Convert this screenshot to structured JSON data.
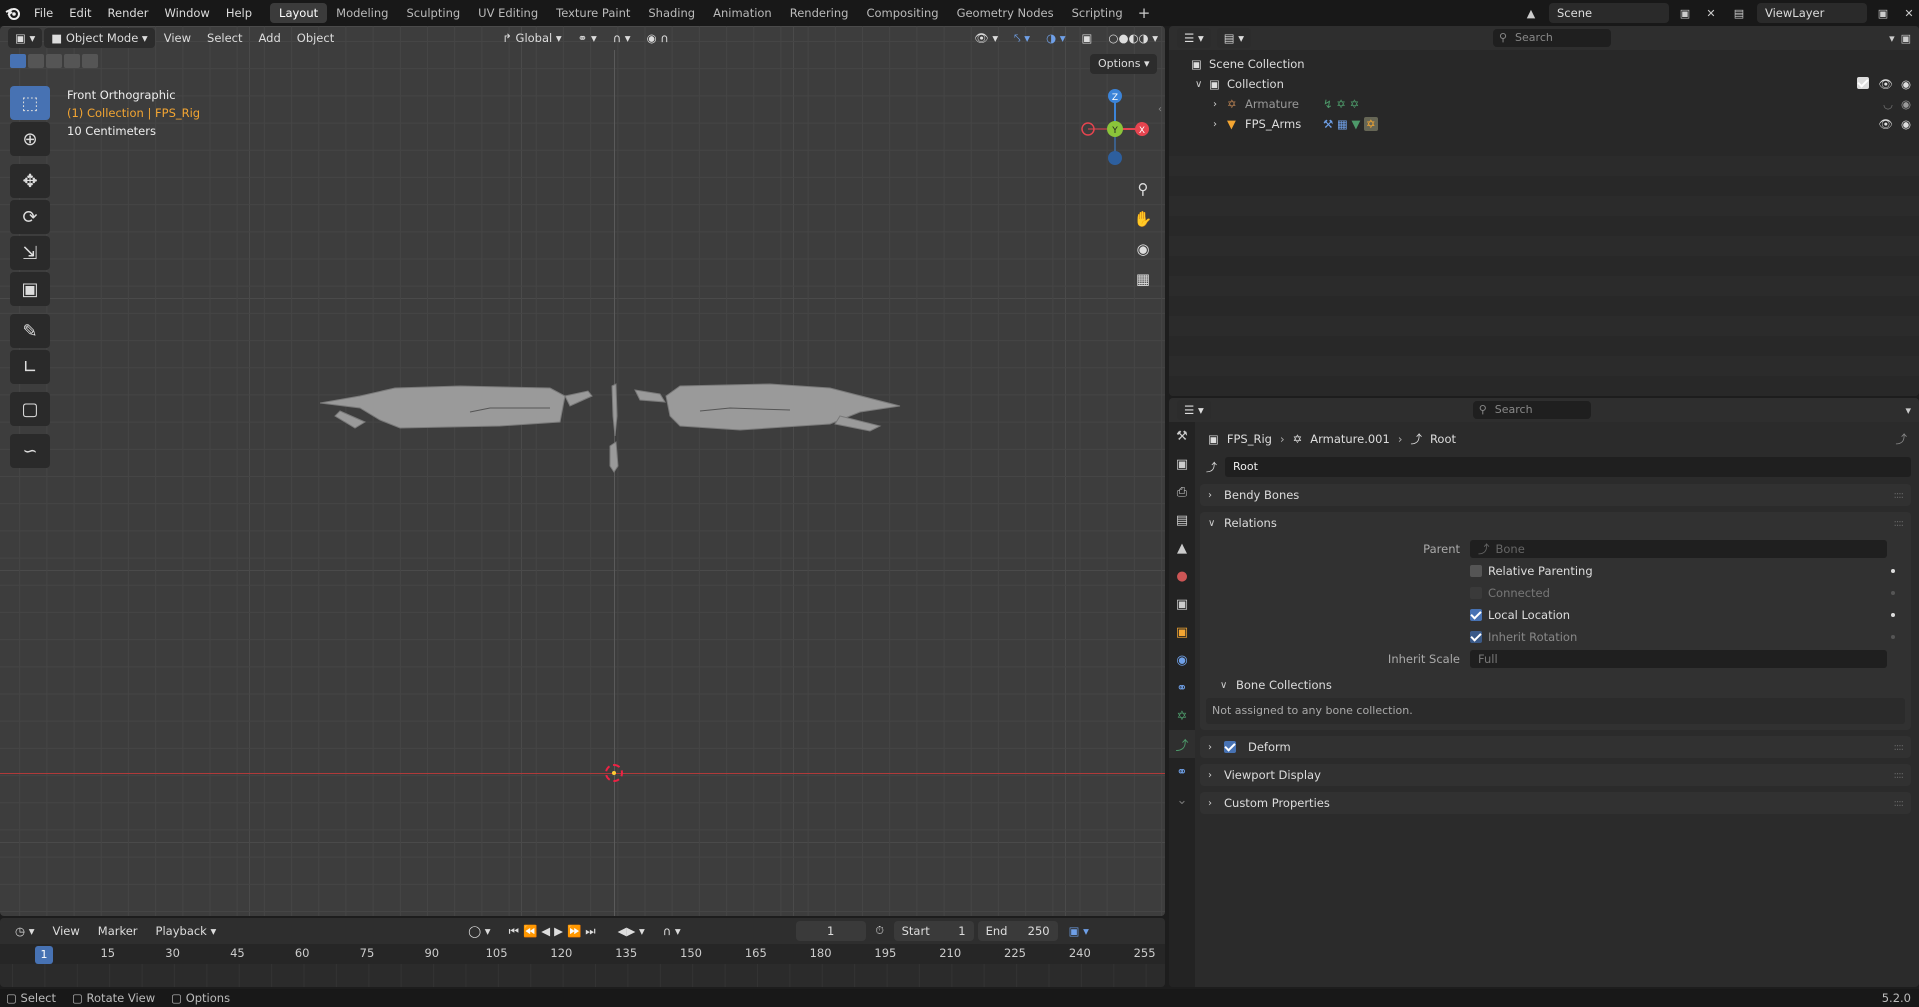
{
  "topbar": {
    "menus": [
      "File",
      "Edit",
      "Render",
      "Window",
      "Help"
    ],
    "workspaces": [
      "Layout",
      "Modeling",
      "Sculpting",
      "UV Editing",
      "Texture Paint",
      "Shading",
      "Animation",
      "Rendering",
      "Compositing",
      "Geometry Nodes",
      "Scripting"
    ],
    "active_workspace": "Layout",
    "scene": "Scene",
    "view_layer": "ViewLayer"
  },
  "viewport": {
    "mode": "Object Mode",
    "menus": [
      "View",
      "Select",
      "Add",
      "Object"
    ],
    "transform_orientation": "Global",
    "options_label": "Options",
    "overlay": {
      "view_name": "Front Orthographic",
      "collection": "(1) Collection | FPS_Rig",
      "scale": "10 Centimeters"
    },
    "gizmo": {
      "z": "Z",
      "y": "Y",
      "x": "X"
    }
  },
  "timeline": {
    "menus": [
      "View",
      "Marker",
      "Playback"
    ],
    "current_frame": "1",
    "start_label": "Start",
    "start": "1",
    "end_label": "End",
    "end": "250",
    "ticks": [
      "1",
      "15",
      "30",
      "45",
      "60",
      "75",
      "90",
      "105",
      "120",
      "135",
      "150",
      "165",
      "180",
      "195",
      "210",
      "225",
      "240",
      "255"
    ]
  },
  "statusbar": {
    "items": [
      "Select",
      "Rotate View",
      "Options"
    ],
    "version": "5.2.0"
  },
  "outliner": {
    "search_placeholder": "Search",
    "scene_collection": "Scene Collection",
    "collection": "Collection",
    "items": [
      {
        "name": "Armature",
        "dim": true
      },
      {
        "name": "FPS_Arms",
        "dim": false
      }
    ]
  },
  "properties": {
    "search_placeholder": "Search",
    "breadcrumb": [
      "FPS_Rig",
      "Armature.001",
      "Root"
    ],
    "bone_name": "Root",
    "panels": {
      "bendy_bones": "Bendy Bones",
      "relations": "Relations",
      "parent_label": "Parent",
      "parent_placeholder": "Bone",
      "relative_parenting": "Relative Parenting",
      "connected": "Connected",
      "local_location": "Local Location",
      "inherit_rotation": "Inherit Rotation",
      "inherit_scale_label": "Inherit Scale",
      "inherit_scale": "Full",
      "bone_collections": "Bone Collections",
      "bone_collections_note": "Not assigned to any bone collection.",
      "deform": "Deform",
      "viewport_display": "Viewport Display",
      "custom_properties": "Custom Properties"
    }
  },
  "colors": {
    "accent": "#4772b3",
    "orange": "#f3a532",
    "x_axis": "#e5444f",
    "y_axis": "#8bc43a",
    "z_axis": "#3c84d8"
  }
}
